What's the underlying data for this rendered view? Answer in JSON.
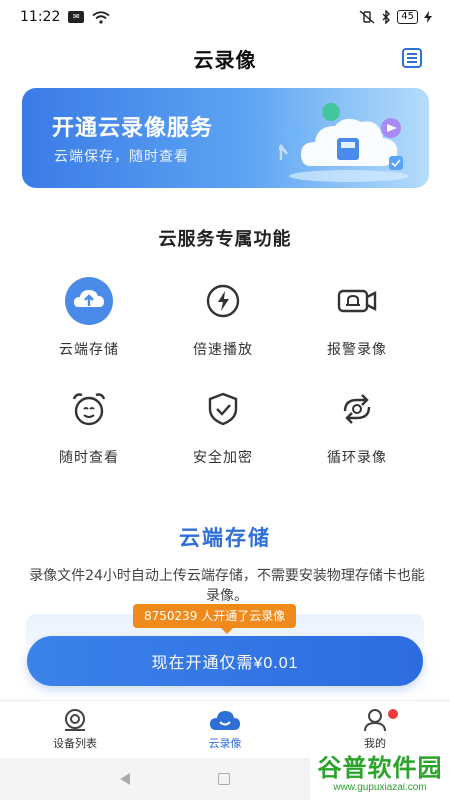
{
  "status_bar": {
    "time": "11:22",
    "battery": "45"
  },
  "header": {
    "title": "云录像"
  },
  "banner": {
    "title": "开通云录像服务",
    "subtitle": "云端保存，随时查看"
  },
  "features": {
    "title": "云服务专属功能",
    "items": [
      {
        "label": "云端存储",
        "icon": "cloud-upload-icon"
      },
      {
        "label": "倍速播放",
        "icon": "lightning-icon"
      },
      {
        "label": "报警录像",
        "icon": "alarm-camera-icon"
      },
      {
        "label": "随时查看",
        "icon": "alarm-clock-icon"
      },
      {
        "label": "安全加密",
        "icon": "shield-check-icon"
      },
      {
        "label": "循环录像",
        "icon": "loop-icon"
      }
    ]
  },
  "section": {
    "title": "云端存储",
    "description": "录像文件24小时自动上传云端存储，不需要安装物理存储卡也能录像。"
  },
  "promo": {
    "tip": "8750239 人开通了云录像",
    "cta": "现在开通仅需¥0.01"
  },
  "bottom_nav": {
    "items": [
      {
        "label": "设备列表",
        "icon": "device-list-icon"
      },
      {
        "label": "云录像",
        "icon": "cloud-icon"
      },
      {
        "label": "我的",
        "icon": "user-icon"
      }
    ]
  },
  "watermark": {
    "big": "谷普软件园",
    "small": "www.gupuxiazai.com"
  },
  "colors": {
    "accent": "#2f6fd8",
    "promo": "#f18a1c",
    "badge": "#f03b3b"
  }
}
